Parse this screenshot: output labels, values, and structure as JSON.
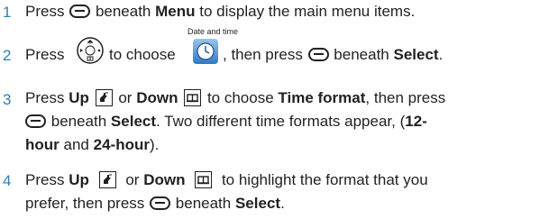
{
  "steps": [
    {
      "number": "1",
      "lines": [
        {
          "t1": "Press",
          "t2": "beneath",
          "bold1": "Menu",
          "t3": "to display the main menu items."
        }
      ]
    },
    {
      "number": "2",
      "icon_caption": "Date and time",
      "t1": "Press",
      "t2": "to choose",
      "t3": ", then press",
      "t4": "beneath",
      "bold1": "Select",
      "t5": "."
    },
    {
      "number": "3",
      "line1": {
        "t1": "Press",
        "bold1": "Up",
        "t2": "or",
        "bold2": "Down",
        "t3": "to choose",
        "bold3": "Time format",
        "t4": ", then press"
      },
      "line2": {
        "t1": "beneath",
        "bold1": "Select",
        "t2": ". Two different time formats appear, (",
        "bold2": "12-"
      },
      "line3": {
        "bold1": "hour",
        "t1": "and",
        "bold2": "24-hour",
        "t2": ")."
      }
    },
    {
      "number": "4",
      "line1": {
        "t1": "Press",
        "bold1": "Up",
        "t2": "or",
        "bold2": "Down",
        "t3": "to highlight the format that you"
      },
      "line2": {
        "t1": "prefer, then press",
        "t2": "beneath",
        "bold1": "Select",
        "t3": "."
      }
    }
  ],
  "colors": {
    "step_number": "#2e7fb8",
    "text": "#231f20",
    "icon_blue": "#2f78c4"
  },
  "icons": {
    "soft_key": "soft-key-icon",
    "nav_key": "navigation-key-icon",
    "up_key": "up-key-icon",
    "down_key": "down-key-icon",
    "date_time": "date-and-time-icon"
  }
}
